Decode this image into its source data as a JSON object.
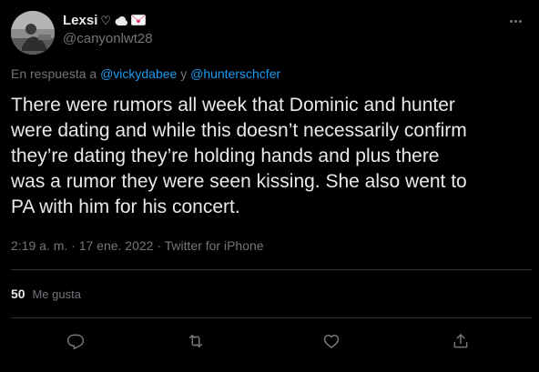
{
  "user": {
    "display_name": "Lexsi",
    "handle": "@canyonlwt28",
    "name_emojis": [
      "heart-outline",
      "cloud",
      "love-letter"
    ]
  },
  "reply": {
    "prefix": "En respuesta a",
    "mention1": "@vickydabee",
    "connector": "y",
    "mention2": "@hunterschcfer"
  },
  "tweet": {
    "text": "There were rumors all week that Dominic and hunter\nwere dating and while this doesn’t necessarily confirm\nthey’re dating they’re holding hands and plus there\nwas a rumor they were seen kissing. She also went to\nPA with him for his concert.",
    "meta": "2:19 a. m. · 17 ene. 2022 · Twitter for iPhone"
  },
  "stats": {
    "likes_count": "50",
    "likes_label": "Me gusta"
  },
  "actions": [
    {
      "name": "reply",
      "icon": "reply-icon"
    },
    {
      "name": "retweet",
      "icon": "retweet-icon"
    },
    {
      "name": "like",
      "icon": "heart-icon"
    },
    {
      "name": "share",
      "icon": "share-icon"
    }
  ],
  "colors": {
    "background": "#000000",
    "text": "#e7e9ea",
    "secondary": "#71767b",
    "accent": "#1d9bf0",
    "divider": "#2f3336"
  }
}
